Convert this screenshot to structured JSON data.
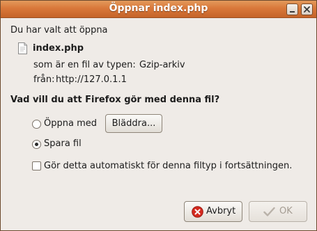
{
  "window": {
    "title": "Öppnar index.php"
  },
  "dialog": {
    "intro": "Du har valt att öppna",
    "file": {
      "name": "index.php",
      "icon": "document-icon",
      "type_label": "som är en fil av typen:",
      "type_value": "Gzip-arkiv",
      "from_label": "från:",
      "from_value": "http://127.0.1.1"
    },
    "question": "Vad vill du att Firefox gör med denna fil?",
    "options": {
      "open_with_label": "Öppna med",
      "open_with_selected": false,
      "browse_label": "Bläddra...",
      "save_label": "Spara fil",
      "save_selected": true,
      "auto_label": "Gör detta automatiskt för denna filtyp i fortsättningen.",
      "auto_checked": false
    },
    "buttons": {
      "cancel_label": "Avbryt",
      "ok_label": "OK",
      "ok_enabled": false
    }
  },
  "colors": {
    "titlebar": "#d9783a",
    "background": "#efebe7",
    "cancel_icon": "#d42a1f"
  }
}
